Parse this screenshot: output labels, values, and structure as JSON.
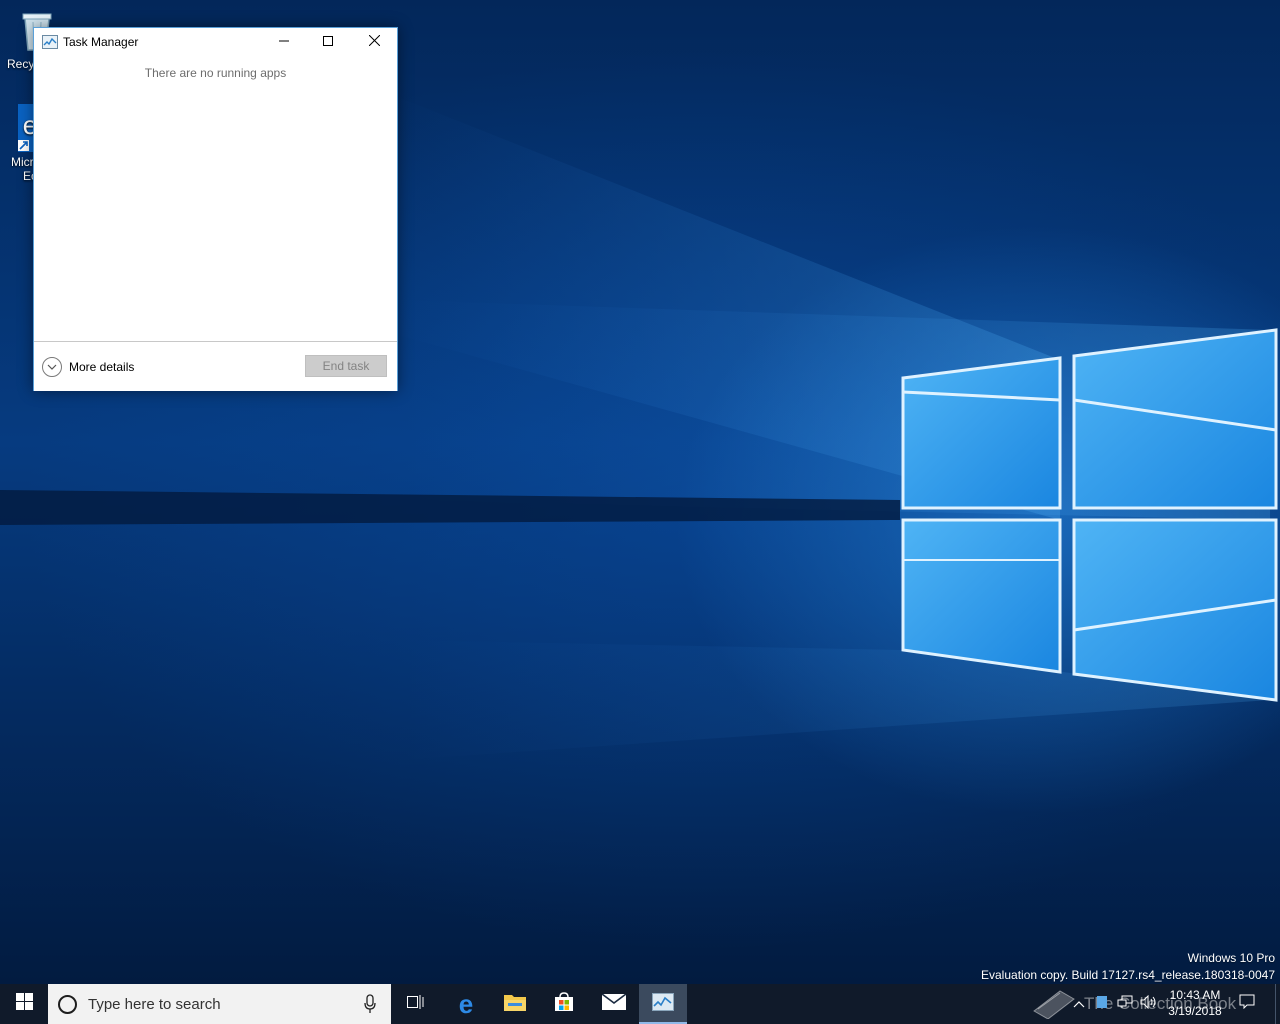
{
  "desktop": {
    "icons": [
      {
        "label": "Recy",
        "icon": "recycle-bin-icon"
      },
      {
        "label": "Micr",
        "label2": "Ec",
        "icon": "edge-icon"
      }
    ]
  },
  "task_manager": {
    "title": "Task Manager",
    "empty_message": "There are no running apps",
    "more_details_label": "More details",
    "end_task_label": "End task",
    "end_task_enabled": false
  },
  "watermark": {
    "edition": "Windows 10 Pro",
    "build": "Evaluation copy. Build 17127.rs4_release.180318-0047"
  },
  "taskbar": {
    "search_placeholder": "Type here to search",
    "pinned": [
      "task-view-icon",
      "edge-icon",
      "file-explorer-icon",
      "store-icon",
      "mail-icon",
      "task-manager-icon"
    ],
    "active_app": "task-manager-icon",
    "clock_time": "10:43 AM",
    "clock_date": "3/19/2018",
    "overlay_text": "The Collection Book"
  },
  "colors": {
    "accent": "#0078d7",
    "taskbar": "#101a2a",
    "window_border": "#5aa0d8"
  }
}
